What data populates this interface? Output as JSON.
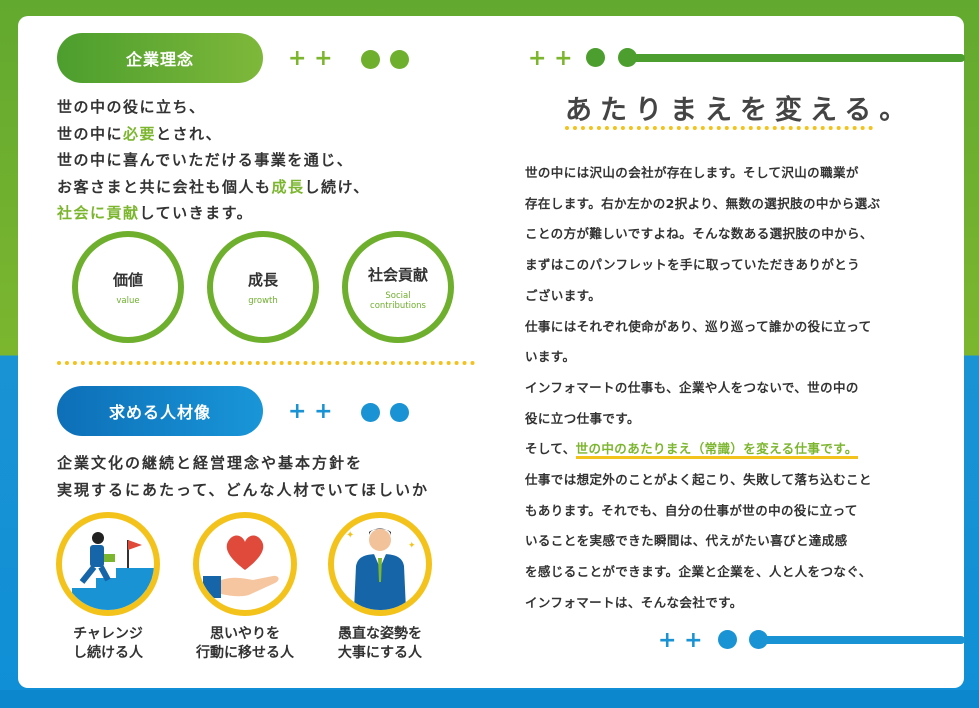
{
  "philosophy": {
    "heading": "企業理念",
    "lines": [
      [
        "世の中の役に立ち、"
      ],
      [
        "世の中に",
        "必要",
        "とされ、"
      ],
      [
        "世の中に喜んでいただける事業を通じ、"
      ],
      [
        "お客さまと共に会社も個人も",
        "成長",
        "し続け、"
      ],
      [
        "",
        "社会に貢献",
        "していきます。"
      ]
    ],
    "values": [
      {
        "jp": "価値",
        "en": "value"
      },
      {
        "jp": "成長",
        "en": "growth"
      },
      {
        "jp": "社会貢献",
        "en": "Social contributions"
      }
    ]
  },
  "talent": {
    "heading": "求める人材像",
    "lead": [
      "企業文化の継続と経営理念や基本方針を",
      "実現するにあたって、どんな人材でいてほしいか"
    ],
    "persons": [
      {
        "label": "チャレンジ\nし続ける人"
      },
      {
        "label": "思いやりを\n行動に移せる人"
      },
      {
        "label": "愚直な姿勢を\n大事にする人"
      }
    ]
  },
  "right": {
    "headline": "あたりまえを変える。",
    "paragraphs": [
      "世の中には沢山の会社が存在します。そして沢山の職業が",
      "存在します。右か左かの2択より、無数の選択肢の中から選ぶ",
      "ことの方が難しいですよね。そんな数ある選択肢の中から、",
      "まずはこのパンフレットを手に取っていただきありがとう",
      "ございます。",
      "仕事にはそれぞれ使命があり、巡り巡って誰かの役に立って",
      "います。",
      "インフォマートの仕事も、企業や人をつないで、世の中の",
      "役に立つ仕事です。"
    ],
    "highlight_prefix": "そして、",
    "highlight": "世の中のあたりまえ（常識）を変える仕事です。",
    "paragraphs2": [
      "仕事では想定外のことがよく起こり、失敗して落ち込むこと",
      "もあります。それでも、自分の仕事が世の中の役に立って",
      "いることを実感できた瞬間は、代えがたい喜びと達成感",
      "を感じることができます。企業と企業を、人と人をつなぐ、",
      "インフォマートは、そんな会社です。"
    ]
  },
  "decor": {
    "plus": "+ +"
  },
  "colors": {
    "green": "#6faf2e",
    "blue": "#1a93d4",
    "yellow": "#f3c31c"
  }
}
